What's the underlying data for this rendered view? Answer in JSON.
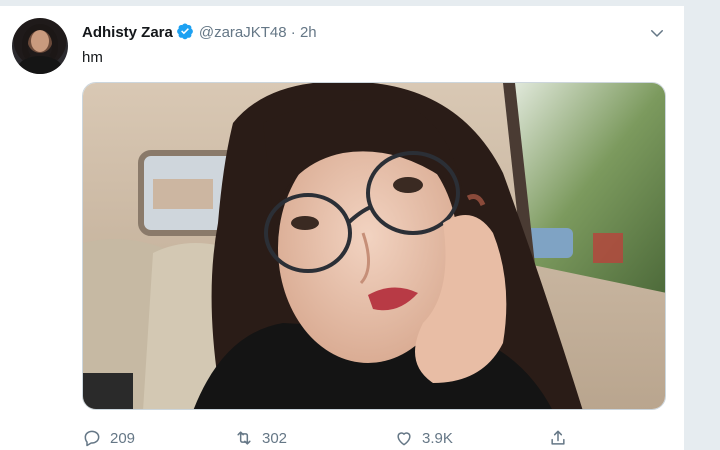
{
  "tweet": {
    "display_name": "Adhisty Zara",
    "handle": "@zaraJKT48",
    "separator": "·",
    "time": "2h",
    "text": "hm",
    "verified": true
  },
  "actions": {
    "reply_count": "209",
    "retweet_count": "302",
    "like_count": "3.9K"
  },
  "colors": {
    "verified": "#1da1f2",
    "muted_text": "#657786",
    "page_background": "#e6ecf0"
  },
  "icons": [
    "verified-icon",
    "chevron-down-icon",
    "reply-icon",
    "retweet-icon",
    "like-icon",
    "share-icon"
  ]
}
